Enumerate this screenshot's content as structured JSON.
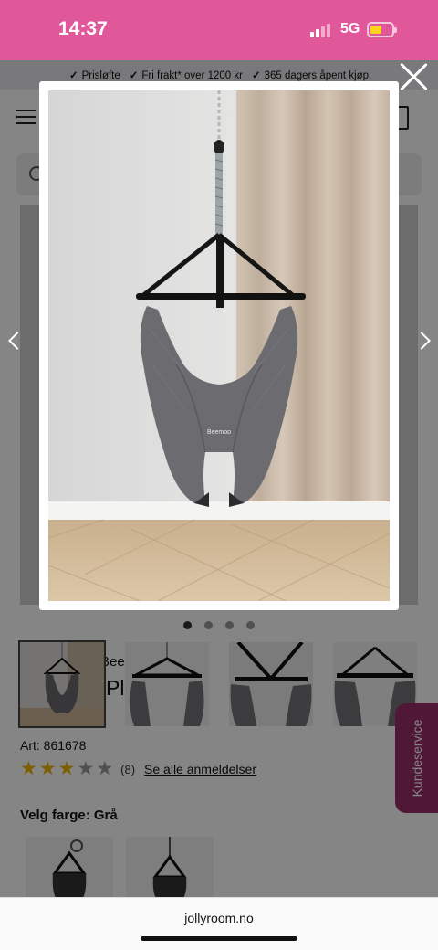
{
  "status": {
    "time": "14:37",
    "network": "5G",
    "battery_level": 0.55
  },
  "usp": [
    {
      "label": "Prisløfte"
    },
    {
      "label": "Fri frakt* over 1200 kr"
    },
    {
      "label": "365 dagers åpent kjøp"
    }
  ],
  "product": {
    "brand_fragment": "Bee",
    "title_fragment": "Pl      pe      Gr",
    "art_label": "Art:",
    "art_number": "861678",
    "rating": 3.5,
    "review_count": "(8)",
    "reviews_link": "Se alle anmeldelser",
    "color_label": "Velg farge: Grå",
    "image_logo": "Beemoo"
  },
  "gallery": {
    "image_count": 4,
    "active_index": 0
  },
  "customer_service": {
    "label": "Kundeservice"
  },
  "browser": {
    "url": "jollyroom.no"
  },
  "colors": {
    "brand_pink": "#e0579a",
    "customer_service": "#9a2e68",
    "star": "#f0b400"
  },
  "icons": [
    "menu-icon",
    "search-icon",
    "bag-icon",
    "close-icon",
    "chevron-left-icon",
    "chevron-right-icon",
    "star-icon",
    "check-icon"
  ]
}
